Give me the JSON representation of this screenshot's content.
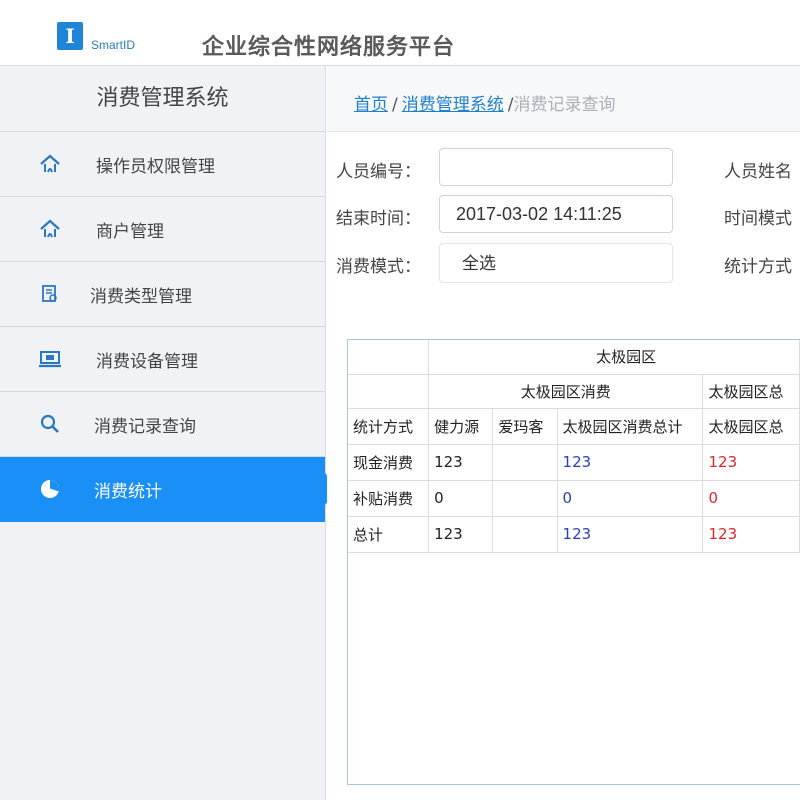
{
  "header": {
    "logo_letter": "I",
    "logo_text": "SmartID",
    "platform_title": "企业综合性网络服务平台"
  },
  "sidebar": {
    "title": "消费管理系统",
    "items": [
      {
        "label": "操作员权限管理",
        "icon": "home-icon"
      },
      {
        "label": "商户管理",
        "icon": "home-icon"
      },
      {
        "label": "消费类型管理",
        "icon": "document-icon"
      },
      {
        "label": "消费设备管理",
        "icon": "monitor-icon"
      },
      {
        "label": "消费记录查询",
        "icon": "search-icon"
      },
      {
        "label": "消费统计",
        "icon": "pie-chart-icon",
        "active": true
      }
    ]
  },
  "breadcrumb": {
    "home": "首页",
    "section": "消费管理系统",
    "current": "消费记录查询",
    "separator": "/"
  },
  "form": {
    "person_id_label": "人员编号：",
    "person_id_value": "",
    "person_name_label": "人员姓名",
    "end_time_label": "结束时间：",
    "end_time_value": "2017-03-02 14:11:25",
    "time_mode_label": "时间模式",
    "consume_mode_label": "消费模式：",
    "consume_mode_value": "全选",
    "stat_method_label": "统计方式"
  },
  "table": {
    "top_header": "太极园区",
    "group_headers": [
      "太极园区消费",
      "太极园区总"
    ],
    "columns": [
      "统计方式",
      "健力源",
      "爱玛客",
      "太极园区消费总计",
      "太极园区总"
    ],
    "rows": [
      {
        "method": "现金消费",
        "jianliyuan": "123",
        "aimake": "",
        "subtotal": "123",
        "total": "123"
      },
      {
        "method": "补贴消费",
        "jianliyuan": "0",
        "aimake": "",
        "subtotal": "0",
        "total": "0"
      },
      {
        "method": "总计",
        "jianliyuan": "123",
        "aimake": "",
        "subtotal": "123",
        "total": "123"
      }
    ]
  },
  "colors": {
    "accent": "#1a8ff5",
    "link": "#1f7fce",
    "subtotal_text": "#2a3fb8",
    "total_text": "#e0262f"
  }
}
